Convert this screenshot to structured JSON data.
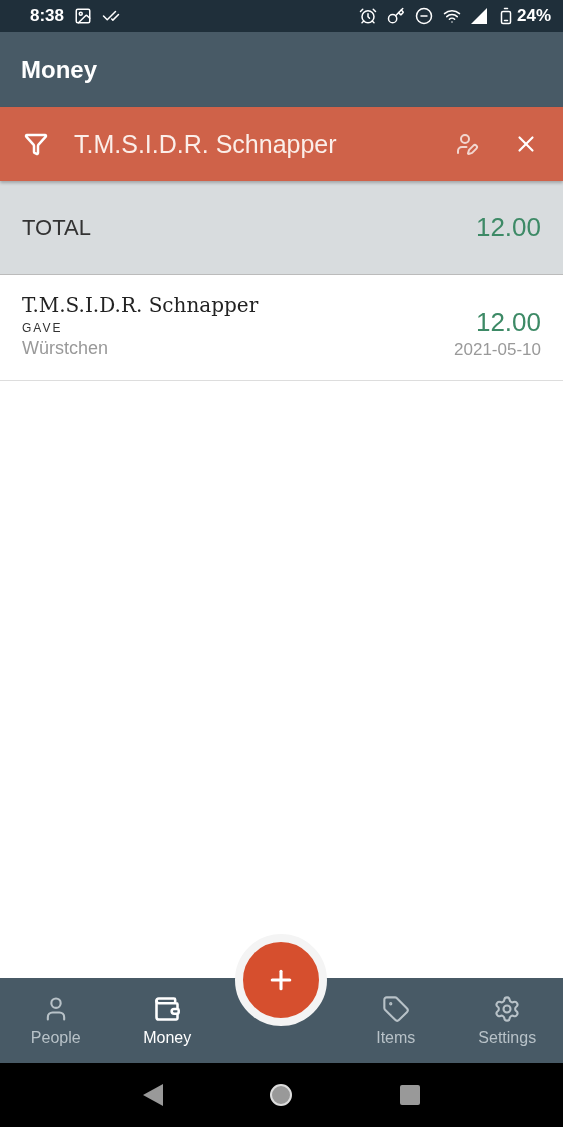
{
  "status_bar": {
    "time": "8:38",
    "battery": "24%"
  },
  "app_bar": {
    "title": "Money"
  },
  "filter_bar": {
    "name": "T.M.S.I.D.R. Schnapper"
  },
  "total": {
    "label": "TOTAL",
    "amount": "12.00"
  },
  "transactions": [
    {
      "person": "T.M.S.I.D.R. Schnapper",
      "type": "GAVE",
      "item": "Würstchen",
      "amount": "12.00",
      "date": "2021-05-10"
    }
  ],
  "bottom_nav": [
    {
      "kind": "person",
      "label": "People",
      "selected": false
    },
    {
      "kind": "wallet",
      "label": "Money",
      "selected": true
    },
    {
      "kind": "tag",
      "label": "Items",
      "selected": false
    },
    {
      "kind": "gear",
      "label": "Settings",
      "selected": false
    }
  ]
}
